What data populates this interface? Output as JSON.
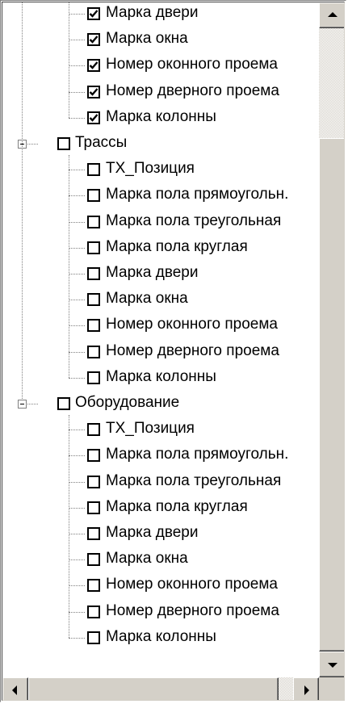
{
  "tree": {
    "group1_tail": [
      {
        "label": "Марка двери",
        "checked": true
      },
      {
        "label": "Марка окна",
        "checked": true
      },
      {
        "label": "Номер оконного проема",
        "checked": true
      },
      {
        "label": "Номер дверного проема",
        "checked": true
      },
      {
        "label": "Марка колонны",
        "checked": true
      }
    ],
    "groups": [
      {
        "label": "Трассы",
        "checked": false,
        "expanded": true,
        "items": [
          {
            "label": "ТХ_Позиция",
            "checked": false
          },
          {
            "label": "Марка пола прямоугольн.",
            "checked": false
          },
          {
            "label": "Марка пола треугольная",
            "checked": false
          },
          {
            "label": "Марка пола круглая",
            "checked": false
          },
          {
            "label": "Марка двери",
            "checked": false
          },
          {
            "label": "Марка окна",
            "checked": false
          },
          {
            "label": "Номер оконного проема",
            "checked": false
          },
          {
            "label": "Номер дверного проема",
            "checked": false
          },
          {
            "label": "Марка колонны",
            "checked": false
          }
        ]
      },
      {
        "label": "Оборудование",
        "checked": false,
        "expanded": true,
        "items": [
          {
            "label": "ТХ_Позиция",
            "checked": false
          },
          {
            "label": "Марка пола прямоугольн.",
            "checked": false
          },
          {
            "label": "Марка пола треугольная",
            "checked": false
          },
          {
            "label": "Марка пола круглая",
            "checked": false
          },
          {
            "label": "Марка двери",
            "checked": false
          },
          {
            "label": "Марка окна",
            "checked": false
          },
          {
            "label": "Номер оконного проема",
            "checked": false
          },
          {
            "label": "Номер дверного проема",
            "checked": false
          },
          {
            "label": "Марка колонны",
            "checked": false
          }
        ]
      }
    ]
  },
  "scrollbars": {
    "vertical_position": 0.18,
    "horizontal_position": 0.0
  },
  "icons": {
    "checkmark": "checkmark-icon",
    "collapse": "minus-box-icon",
    "scroll_up": "triangle-up-icon",
    "scroll_down": "triangle-down-icon",
    "scroll_left": "triangle-left-icon",
    "scroll_right": "triangle-right-icon"
  }
}
